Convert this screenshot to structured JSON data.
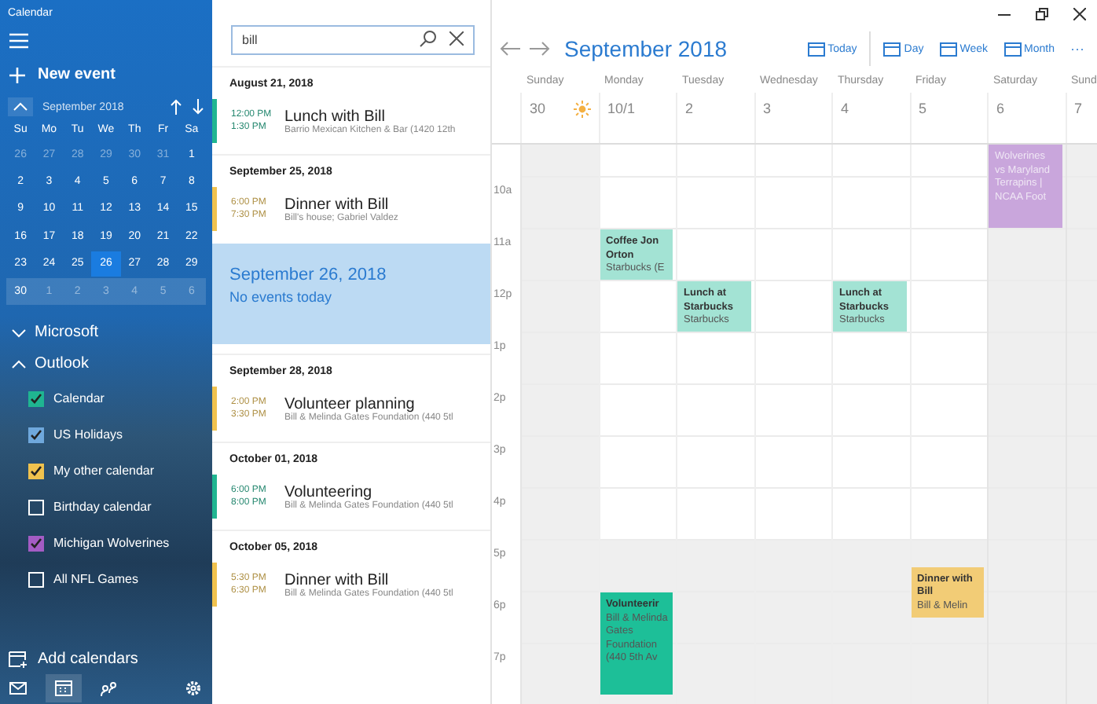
{
  "app_title": "Calendar",
  "sidebar": {
    "new_event": "New event",
    "mini_calendar": {
      "title": "September 2018",
      "weekdays": [
        "Su",
        "Mo",
        "Tu",
        "We",
        "Th",
        "Fr",
        "Sa"
      ],
      "weeks": [
        {
          "selected": false,
          "days": [
            {
              "label": "26",
              "dim": true,
              "selected": false
            },
            {
              "label": "27",
              "dim": true,
              "selected": false
            },
            {
              "label": "28",
              "dim": true,
              "selected": false
            },
            {
              "label": "29",
              "dim": true,
              "selected": false
            },
            {
              "label": "30",
              "dim": true,
              "selected": false
            },
            {
              "label": "31",
              "dim": true,
              "selected": false
            },
            {
              "label": "1",
              "dim": false,
              "selected": false
            }
          ]
        },
        {
          "selected": false,
          "days": [
            {
              "label": "2",
              "dim": false,
              "selected": false
            },
            {
              "label": "3",
              "dim": false,
              "selected": false
            },
            {
              "label": "4",
              "dim": false,
              "selected": false
            },
            {
              "label": "5",
              "dim": false,
              "selected": false
            },
            {
              "label": "6",
              "dim": false,
              "selected": false
            },
            {
              "label": "7",
              "dim": false,
              "selected": false
            },
            {
              "label": "8",
              "dim": false,
              "selected": false
            }
          ]
        },
        {
          "selected": false,
          "days": [
            {
              "label": "9",
              "dim": false,
              "selected": false
            },
            {
              "label": "10",
              "dim": false,
              "selected": false
            },
            {
              "label": "11",
              "dim": false,
              "selected": false
            },
            {
              "label": "12",
              "dim": false,
              "selected": false
            },
            {
              "label": "13",
              "dim": false,
              "selected": false
            },
            {
              "label": "14",
              "dim": false,
              "selected": false
            },
            {
              "label": "15",
              "dim": false,
              "selected": false
            }
          ]
        },
        {
          "selected": false,
          "days": [
            {
              "label": "16",
              "dim": false,
              "selected": false
            },
            {
              "label": "17",
              "dim": false,
              "selected": false
            },
            {
              "label": "18",
              "dim": false,
              "selected": false
            },
            {
              "label": "19",
              "dim": false,
              "selected": false
            },
            {
              "label": "20",
              "dim": false,
              "selected": false
            },
            {
              "label": "21",
              "dim": false,
              "selected": false
            },
            {
              "label": "22",
              "dim": false,
              "selected": false
            }
          ]
        },
        {
          "selected": false,
          "days": [
            {
              "label": "23",
              "dim": false,
              "selected": false
            },
            {
              "label": "24",
              "dim": false,
              "selected": false
            },
            {
              "label": "25",
              "dim": false,
              "selected": false
            },
            {
              "label": "26",
              "dim": false,
              "selected": true
            },
            {
              "label": "27",
              "dim": false,
              "selected": false
            },
            {
              "label": "28",
              "dim": false,
              "selected": false
            },
            {
              "label": "29",
              "dim": false,
              "selected": false
            }
          ]
        },
        {
          "selected": true,
          "days": [
            {
              "label": "30",
              "dim": false,
              "selected": false
            },
            {
              "label": "1",
              "dim": true,
              "selected": false
            },
            {
              "label": "2",
              "dim": true,
              "selected": false
            },
            {
              "label": "3",
              "dim": true,
              "selected": false
            },
            {
              "label": "4",
              "dim": true,
              "selected": false
            },
            {
              "label": "5",
              "dim": true,
              "selected": false
            },
            {
              "label": "6",
              "dim": true,
              "selected": false
            }
          ]
        }
      ]
    },
    "accounts": [
      {
        "name": "Microsoft",
        "expanded": false
      },
      {
        "name": "Outlook",
        "expanded": true
      }
    ],
    "calendars": [
      {
        "name": "Calendar",
        "checked": true,
        "color": "#1fb591"
      },
      {
        "name": "US Holidays",
        "checked": true,
        "color": "#6fa8dc"
      },
      {
        "name": "My other calendar",
        "checked": true,
        "color": "#f0c24e"
      },
      {
        "name": "Birthday calendar",
        "checked": false
      },
      {
        "name": "Michigan Wolverines",
        "checked": true,
        "color": "#a45cc4"
      },
      {
        "name": "All NFL Games",
        "checked": false
      }
    ],
    "add_calendars": "Add calendars"
  },
  "search": {
    "value": "bill"
  },
  "results": [
    {
      "date": "August 21, 2018",
      "selected": false,
      "events": [
        {
          "start": "12:00 PM",
          "end": "1:30 PM",
          "title": "Lunch with Bill",
          "location": "Barrio Mexican Kitchen & Bar (1420 12th",
          "color": "#1fb591"
        }
      ]
    },
    {
      "date": "September 25, 2018",
      "selected": false,
      "events": [
        {
          "start": "6:00 PM",
          "end": "7:30 PM",
          "title": "Dinner with Bill",
          "location": "Bill's house; Gabriel Valdez",
          "color": "#f0c24e"
        }
      ]
    },
    {
      "date": "September 26, 2018",
      "selected": true,
      "note": "No events today"
    },
    {
      "date": "September 28, 2018",
      "selected": false,
      "events": [
        {
          "start": "2:00 PM",
          "end": "3:30 PM",
          "title": "Volunteer planning",
          "location": "Bill & Melinda Gates Foundation (440 5tl",
          "color": "#f0c24e"
        }
      ]
    },
    {
      "date": "October 01, 2018",
      "selected": false,
      "events": [
        {
          "start": "6:00 PM",
          "end": "8:00 PM",
          "title": "Volunteering",
          "location": "Bill & Melinda Gates Foundation (440 5tl",
          "color": "#1fb591"
        }
      ]
    },
    {
      "date": "October 05, 2018",
      "selected": false,
      "events": [
        {
          "start": "5:30 PM",
          "end": "6:30 PM",
          "title": "Dinner with Bill",
          "location": "Bill & Melinda Gates Foundation (440 5tl",
          "color": "#f0c24e"
        }
      ]
    }
  ],
  "main": {
    "title": "September 2018",
    "views": [
      {
        "label": "Today",
        "selected": false
      },
      {
        "label": "Day",
        "selected": false
      },
      {
        "label": "Week",
        "selected": false
      },
      {
        "label": "Month",
        "selected": false
      }
    ],
    "more": "···",
    "columns": [
      {
        "name": "Sunday",
        "date": "30",
        "weekend": true,
        "weather_icon": true
      },
      {
        "name": "Monday",
        "date": "10/1",
        "weekend": false,
        "weather_icon": false,
        "events": [
          {
            "title": "Coffee Jon Orton",
            "location": "Starbucks (E",
            "color": "#a3e3d4"
          },
          {
            "title": "Volunteerir",
            "location": "Bill & Melinda Gates Foundation (440 5th Av",
            "color": "#1dbf98"
          }
        ]
      },
      {
        "name": "Tuesday",
        "date": "2",
        "weekend": false,
        "weather_icon": false,
        "events": [
          {
            "title": "Lunch at Starbucks",
            "location": "Starbucks",
            "color": "#a3e3d4"
          }
        ]
      },
      {
        "name": "Wednesday",
        "date": "3",
        "weekend": false,
        "weather_icon": false
      },
      {
        "name": "Thursday",
        "date": "4",
        "weekend": false,
        "weather_icon": false,
        "events": [
          {
            "title": "Lunch at Starbucks",
            "location": "Starbucks",
            "color": "#a3e3d4"
          }
        ]
      },
      {
        "name": "Friday",
        "date": "5",
        "weekend": false,
        "weather_icon": false,
        "events": [
          {
            "title": "Dinner with Bill",
            "location": "Bill & Melin",
            "color": "#f2cc76"
          }
        ]
      },
      {
        "name": "Saturday",
        "date": "6",
        "weekend": true,
        "weather_icon": false,
        "events": [
          {
            "title": "Wolverines vs Maryland Terrapins | NCAA Foot",
            "color": "#c9a6dc"
          }
        ]
      },
      {
        "name": "Sund",
        "date": "7",
        "weekend": true
      }
    ],
    "hours": [
      "10a",
      "11a",
      "12p",
      "1p",
      "2p",
      "3p",
      "4p",
      "5p",
      "6p",
      "7p"
    ]
  }
}
